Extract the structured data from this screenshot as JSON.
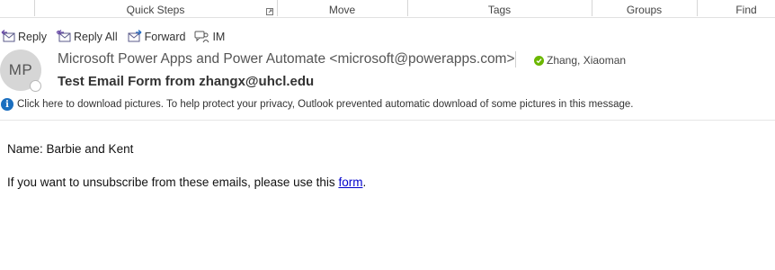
{
  "ribbon": {
    "groups": [
      "Quick Steps",
      "Move",
      "Tags",
      "Groups",
      "Find"
    ]
  },
  "actions": {
    "reply": "Reply",
    "reply_all": "Reply All",
    "forward": "Forward",
    "im": "IM"
  },
  "message": {
    "avatar_initials": "MP",
    "sender": "Microsoft Power Apps and Power Automate <microsoft@powerapps.com>",
    "recipient": "Zhang, Xiaoman",
    "subject": "Test Email Form from zhangx@uhcl.edu",
    "infobar": "Click here to download pictures. To help protect your privacy, Outlook prevented automatic download of some pictures in this message."
  },
  "body": {
    "line1": "Name: Barbie and Kent",
    "line2_prefix": "If you want to unsubscribe from these emails, please use this ",
    "link_text": "form",
    "line2_suffix": "."
  },
  "colors": {
    "presence_available": "#6bb700",
    "info_blue": "#1b6fbf",
    "link": "#0000cc"
  }
}
